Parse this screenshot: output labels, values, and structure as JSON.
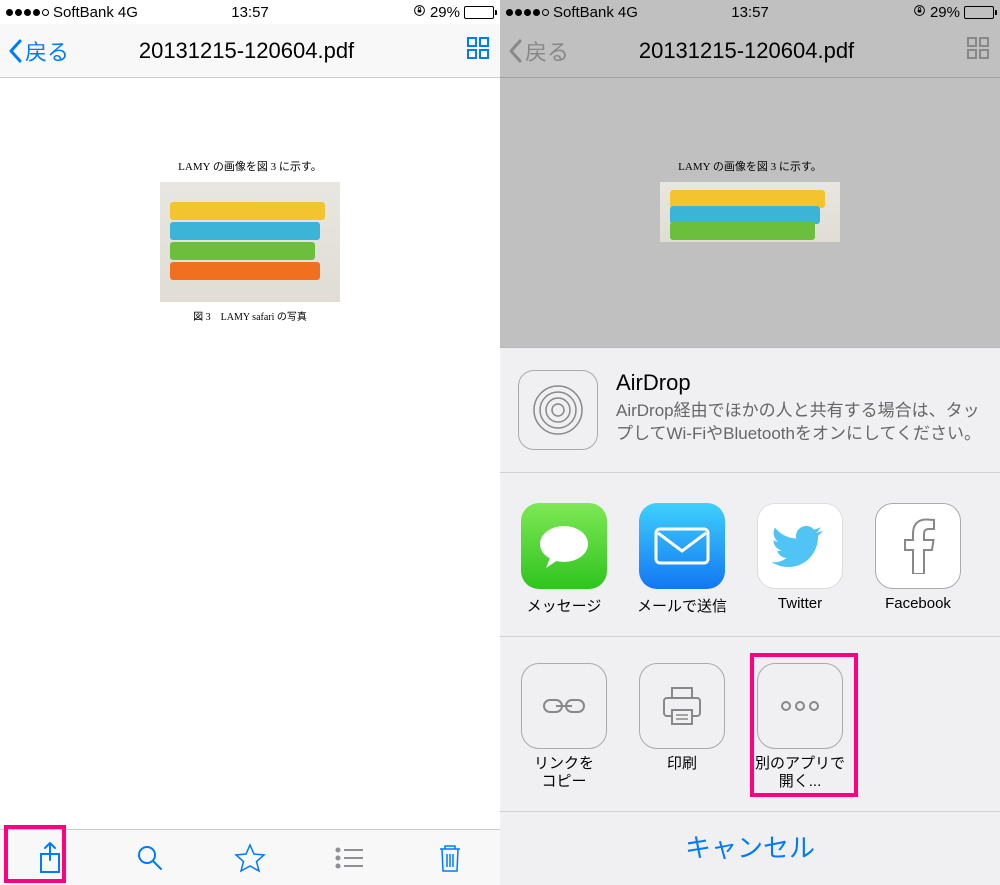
{
  "status": {
    "carrier": "SoftBank",
    "network": "4G",
    "time": "13:57",
    "battery_pct": "29%"
  },
  "nav": {
    "back_label": "戻る",
    "title": "20131215-120604.pdf"
  },
  "document": {
    "header_text": "LAMY の画像を図 3 に示す。",
    "caption": "図 3　LAMY safari の写真"
  },
  "share": {
    "airdrop_title": "AirDrop",
    "airdrop_desc": "AirDrop経由でほかの人と共有する場合は、タップしてWi-FiやBluetoothをオンにしてください。",
    "apps": [
      {
        "label": "メッセージ",
        "name": "messages"
      },
      {
        "label": "メールで送信",
        "name": "mail"
      },
      {
        "label": "Twitter",
        "name": "twitter"
      },
      {
        "label": "Facebook",
        "name": "facebook"
      }
    ],
    "actions": [
      {
        "label": "リンクを\nコピー",
        "name": "copy-link"
      },
      {
        "label": "印刷",
        "name": "print"
      },
      {
        "label": "別のアプリで\n開く...",
        "name": "open-in"
      }
    ],
    "cancel_label": "キャンセル"
  }
}
